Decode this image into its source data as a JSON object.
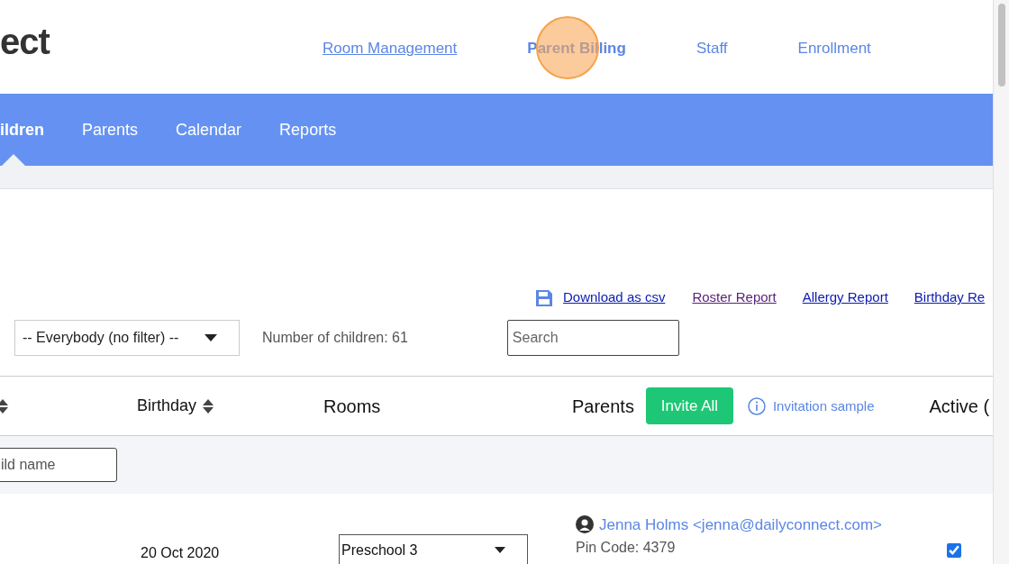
{
  "header": {
    "logo": "ect",
    "nav": [
      {
        "label": "Room Management",
        "selected": false,
        "underlined": true
      },
      {
        "label": "Parent Billing",
        "selected": true,
        "underlined": false
      },
      {
        "label": "Staff",
        "selected": false,
        "underlined": false
      },
      {
        "label": "Enrollment",
        "selected": false,
        "underlined": false
      }
    ],
    "click_marker": true
  },
  "tabs": [
    {
      "label": "ildren",
      "selected": true
    },
    {
      "label": "Parents",
      "selected": false
    },
    {
      "label": "Calendar",
      "selected": false
    },
    {
      "label": "Reports",
      "selected": false
    }
  ],
  "report_links": [
    {
      "label": "Download as csv",
      "visited": false,
      "kind": "download"
    },
    {
      "label": "Roster Report",
      "visited": true,
      "kind": "link"
    },
    {
      "label": "Allergy Report",
      "visited": false,
      "kind": "link"
    },
    {
      "label": "Birthday Re",
      "visited": false,
      "kind": "link"
    }
  ],
  "filter": {
    "value": "-- Everybody (no filter) --",
    "count": "Number of children: 61",
    "search_placeholder": "Search"
  },
  "table": {
    "columns": [
      {
        "sortable": true
      },
      {
        "label": "Birthday",
        "sortable": true
      },
      {
        "label": "Rooms",
        "sortable": false
      },
      {
        "label": "Parents",
        "sortable": false
      },
      {
        "label": "Active (",
        "sortable": false
      }
    ],
    "invite_button": "Invite All",
    "invitation_sample": "Invitation sample",
    "name_filter_placeholder": "ild name",
    "rows": [
      {
        "birthday": "20 Oct 2020",
        "room": "Preschool 3",
        "parent": "Jenna Holms <jenna@dailyconnect.com>",
        "pin": "Pin Code: 4379",
        "active": true
      }
    ]
  }
}
